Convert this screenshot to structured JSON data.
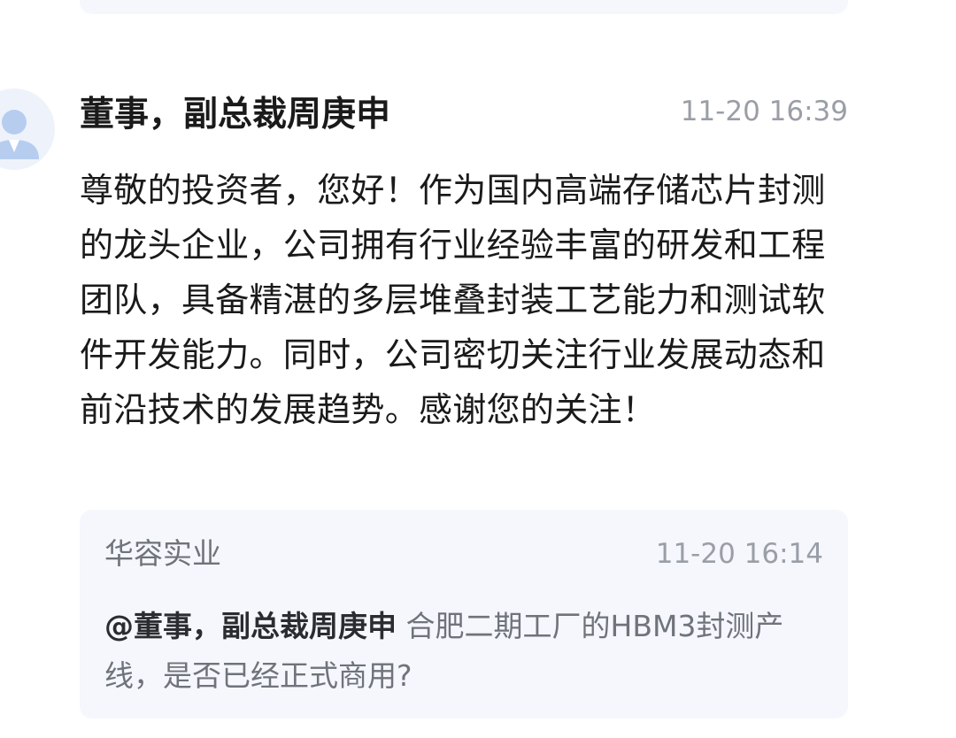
{
  "answer": {
    "author": "董事，副总裁周庚申",
    "time": "11-20 16:39",
    "text": "尊敬的投资者，您好！作为国内高端存储芯片封测的龙头企业，公司拥有行业经验丰富的研发和工程团队，具备精湛的多层堆叠封装工艺能力和测试软件开发能力。同时，公司密切关注行业发展动态和前沿技术的发展趋势。感谢您的关注！"
  },
  "question": {
    "author": "华容实业",
    "time": "11-20 16:14",
    "mention": "@董事，副总裁周庚申",
    "text": "合肥二期工厂的HBM3封测产线，是否已经正式商用?"
  },
  "colors": {
    "card_bg": "#f5f7fc",
    "secondary_text": "#9a9ea6",
    "avatar_blue": "#b6cdf0"
  },
  "icons": {
    "avatar": "user-avatar-icon"
  }
}
